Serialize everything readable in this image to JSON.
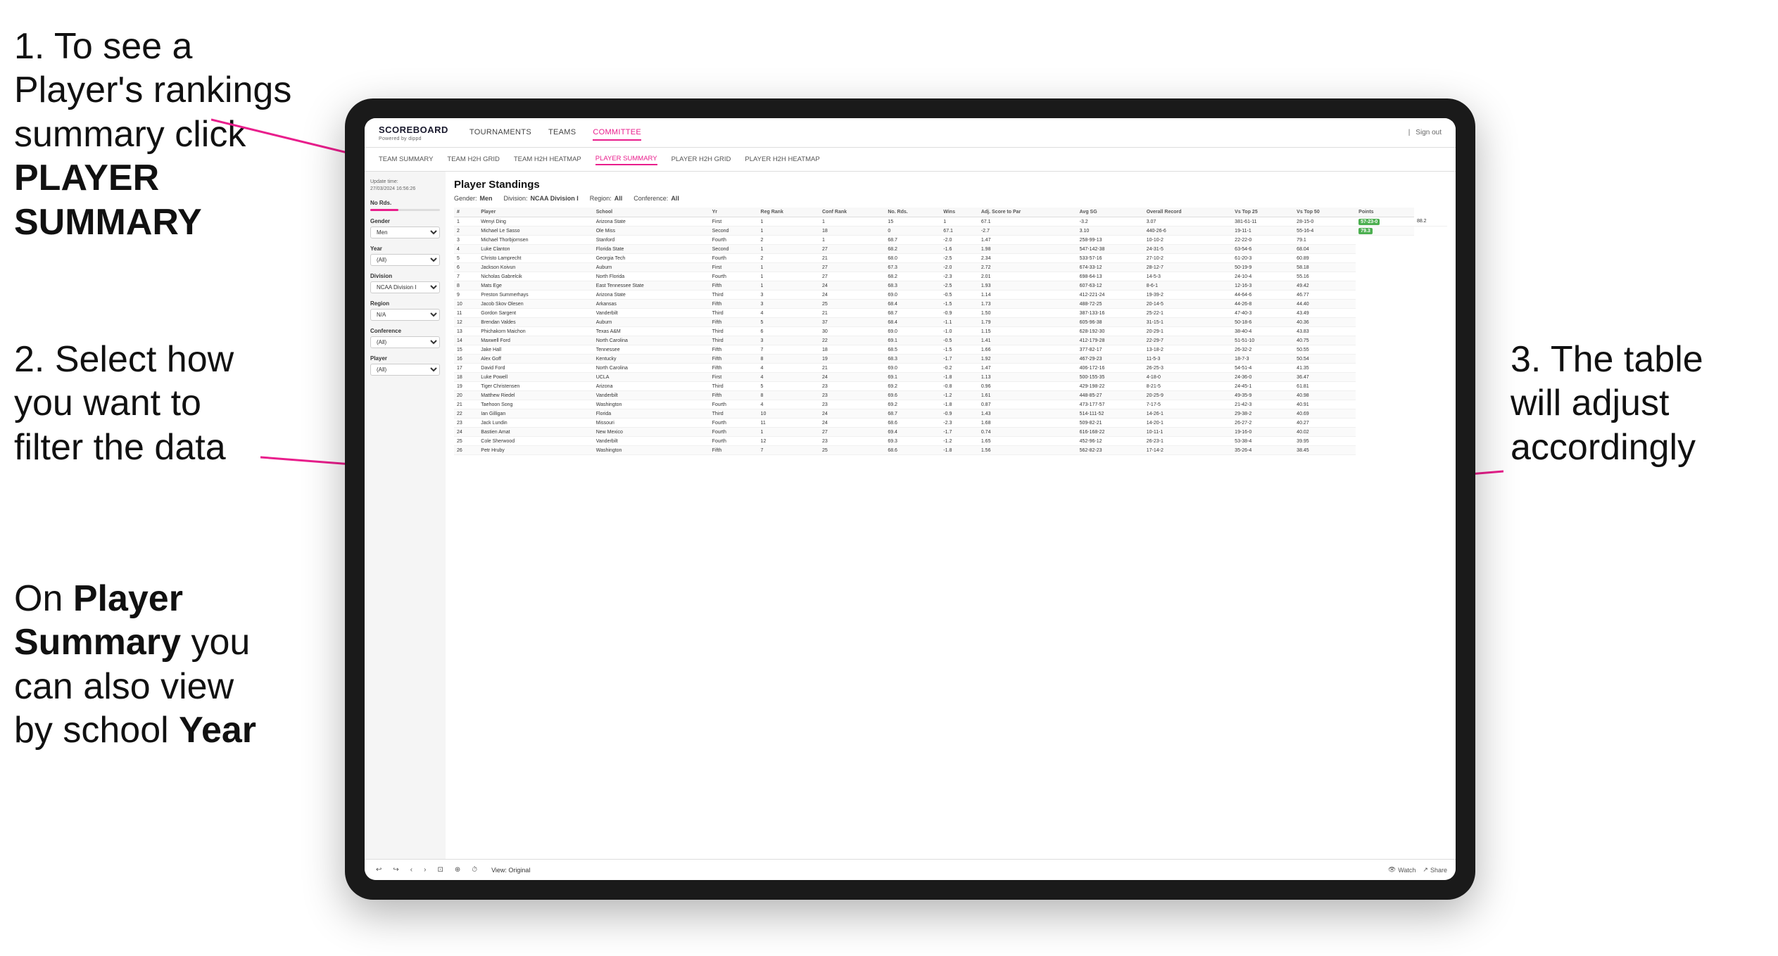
{
  "instructions": {
    "step1": "1. To see a Player's rankings summary click ",
    "step1_bold": "PLAYER SUMMARY",
    "step2_pre": "2. Select how you want to filter the data",
    "step3": "3. The table will adjust accordingly",
    "step_bottom_pre": "On ",
    "step_bottom_bold1": "Player Summary",
    "step_bottom_mid": " you can also view by school ",
    "step_bottom_bold2": "Year"
  },
  "header": {
    "logo": "SCOREBOARD",
    "logo_sub": "Powered by dippd",
    "nav": [
      "TOURNAMENTS",
      "TEAMS",
      "COMMITTEE"
    ],
    "nav_active": "COMMITTEE",
    "right_text": "Sign out"
  },
  "subnav": {
    "items": [
      "TEAM SUMMARY",
      "TEAM H2H GRID",
      "TEAM H2H HEATMAP",
      "PLAYER SUMMARY",
      "PLAYER H2H GRID",
      "PLAYER H2H HEATMAP"
    ],
    "active": "PLAYER SUMMARY"
  },
  "filters": {
    "update_label": "Update time:",
    "update_time": "27/03/2024 16:56:26",
    "no_rds_label": "No Rds.",
    "gender_label": "Gender",
    "gender_value": "Men",
    "year_label": "Year",
    "year_value": "(All)",
    "division_label": "Division",
    "division_value": "NCAA Division I",
    "region_label": "Region",
    "region_value": "N/A",
    "conference_label": "Conference",
    "conference_value": "(All)",
    "player_label": "Player",
    "player_value": "(All)"
  },
  "table": {
    "title": "Player Standings",
    "filters": {
      "gender_label": "Gender:",
      "gender_value": "Men",
      "division_label": "Division:",
      "division_value": "NCAA Division I",
      "region_label": "Region:",
      "region_value": "All",
      "conference_label": "Conference:",
      "conference_value": "All"
    },
    "columns": [
      "#",
      "Player",
      "School",
      "Yr",
      "Reg Rank",
      "Conf Rank",
      "No. Rds.",
      "Wins",
      "Adj. Score to Par",
      "Avg SG",
      "Overall Record",
      "Vs Top 25",
      "Vs Top 50",
      "Points"
    ],
    "rows": [
      [
        "1",
        "Wenyi Ding",
        "Arizona State",
        "First",
        "1",
        "1",
        "15",
        "1",
        "67.1",
        "-3.2",
        "3.07",
        "381-61-11",
        "28-15-0",
        "57-23-0",
        "88.2"
      ],
      [
        "2",
        "Michael Le Sasso",
        "Ole Miss",
        "Second",
        "1",
        "18",
        "0",
        "67.1",
        "-2.7",
        "3.10",
        "440-26-6",
        "19-11-1",
        "55-16-4",
        "79.3"
      ],
      [
        "3",
        "Michael Thorbjornsen",
        "Stanford",
        "Fourth",
        "2",
        "1",
        "68.7",
        "-2.0",
        "1.47",
        "258-99-13",
        "10-10-2",
        "22-22-0",
        "79.1"
      ],
      [
        "4",
        "Luke Clanton",
        "Florida State",
        "Second",
        "1",
        "27",
        "68.2",
        "-1.6",
        "1.98",
        "547-142-38",
        "24-31-5",
        "63-54-6",
        "68.04"
      ],
      [
        "5",
        "Christo Lamprecht",
        "Georgia Tech",
        "Fourth",
        "2",
        "21",
        "68.0",
        "-2.5",
        "2.34",
        "533-57-16",
        "27-10-2",
        "61-20-3",
        "60.89"
      ],
      [
        "6",
        "Jackson Koivun",
        "Auburn",
        "First",
        "1",
        "27",
        "67.3",
        "-2.0",
        "2.72",
        "674-33-12",
        "28-12-7",
        "50-19-9",
        "58.18"
      ],
      [
        "7",
        "Nicholas Gabrelcik",
        "North Florida",
        "Fourth",
        "1",
        "27",
        "68.2",
        "-2.3",
        "2.01",
        "698-64-13",
        "14-5-3",
        "24-10-4",
        "55.16"
      ],
      [
        "8",
        "Mats Ege",
        "East Tennessee State",
        "Fifth",
        "1",
        "24",
        "68.3",
        "-2.5",
        "1.93",
        "607-63-12",
        "8-6-1",
        "12-16-3",
        "49.42"
      ],
      [
        "9",
        "Preston Summerhays",
        "Arizona State",
        "Third",
        "3",
        "24",
        "69.0",
        "-0.5",
        "1.14",
        "412-221-24",
        "19-39-2",
        "44-64-6",
        "46.77"
      ],
      [
        "10",
        "Jacob Skov Olesen",
        "Arkansas",
        "Fifth",
        "3",
        "25",
        "68.4",
        "-1.5",
        "1.73",
        "488-72-25",
        "20-14-5",
        "44-26-8",
        "44.40"
      ],
      [
        "11",
        "Gordon Sargent",
        "Vanderbilt",
        "Third",
        "4",
        "21",
        "68.7",
        "-0.9",
        "1.50",
        "387-133-16",
        "25-22-1",
        "47-40-3",
        "43.49"
      ],
      [
        "12",
        "Brendan Valdes",
        "Auburn",
        "Fifth",
        "5",
        "37",
        "68.4",
        "-1.1",
        "1.79",
        "605-96-38",
        "31-15-1",
        "50-18-6",
        "40.36"
      ],
      [
        "13",
        "Phichakorn Maichon",
        "Texas A&M",
        "Third",
        "6",
        "30",
        "69.0",
        "-1.0",
        "1.15",
        "628-192-30",
        "20-29-1",
        "38-40-4",
        "43.83"
      ],
      [
        "14",
        "Maxwell Ford",
        "North Carolina",
        "Third",
        "3",
        "22",
        "69.1",
        "-0.5",
        "1.41",
        "412-179-28",
        "22-29-7",
        "51-51-10",
        "40.75"
      ],
      [
        "15",
        "Jake Hall",
        "Tennessee",
        "Fifth",
        "7",
        "18",
        "68.5",
        "-1.5",
        "1.66",
        "377-82-17",
        "13-18-2",
        "26-32-2",
        "50.55"
      ],
      [
        "16",
        "Alex Goff",
        "Kentucky",
        "Fifth",
        "8",
        "19",
        "68.3",
        "-1.7",
        "1.92",
        "467-29-23",
        "11-5-3",
        "18-7-3",
        "50.54"
      ],
      [
        "17",
        "David Ford",
        "North Carolina",
        "Fifth",
        "4",
        "21",
        "69.0",
        "-0.2",
        "1.47",
        "406-172-16",
        "26-25-3",
        "54-51-4",
        "41.35"
      ],
      [
        "18",
        "Luke Powell",
        "UCLA",
        "First",
        "4",
        "24",
        "69.1",
        "-1.8",
        "1.13",
        "500-155-35",
        "4-18-0",
        "24-36-0",
        "36.47"
      ],
      [
        "19",
        "Tiger Christensen",
        "Arizona",
        "Third",
        "5",
        "23",
        "69.2",
        "-0.8",
        "0.96",
        "429-198-22",
        "8-21-5",
        "24-45-1",
        "61.81"
      ],
      [
        "20",
        "Matthew Riedel",
        "Vanderbilt",
        "Fifth",
        "8",
        "23",
        "69.6",
        "-1.2",
        "1.61",
        "448-85-27",
        "20-25-9",
        "49-35-9",
        "40.98"
      ],
      [
        "21",
        "Taehoon Song",
        "Washington",
        "Fourth",
        "4",
        "23",
        "69.2",
        "-1.8",
        "0.87",
        "473-177-57",
        "7-17-5",
        "21-42-3",
        "40.91"
      ],
      [
        "22",
        "Ian Gilligan",
        "Florida",
        "Third",
        "10",
        "24",
        "68.7",
        "-0.9",
        "1.43",
        "514-111-52",
        "14-26-1",
        "29-38-2",
        "40.69"
      ],
      [
        "23",
        "Jack Lundin",
        "Missouri",
        "Fourth",
        "11",
        "24",
        "68.6",
        "-2.3",
        "1.68",
        "509-82-21",
        "14-20-1",
        "26-27-2",
        "40.27"
      ],
      [
        "24",
        "Bastien Amat",
        "New Mexico",
        "Fourth",
        "1",
        "27",
        "69.4",
        "-1.7",
        "0.74",
        "616-168-22",
        "10-11-1",
        "19-16-0",
        "40.02"
      ],
      [
        "25",
        "Cole Sherwood",
        "Vanderbilt",
        "Fourth",
        "12",
        "23",
        "69.3",
        "-1.2",
        "1.65",
        "452-96-12",
        "26-23-1",
        "53-38-4",
        "39.95"
      ],
      [
        "26",
        "Petr Hruby",
        "Washington",
        "Fifth",
        "7",
        "25",
        "68.6",
        "-1.8",
        "1.56",
        "562-82-23",
        "17-14-2",
        "35-26-4",
        "38.45"
      ]
    ]
  },
  "toolbar": {
    "view_label": "View: Original",
    "watch_label": "Watch",
    "share_label": "Share"
  }
}
